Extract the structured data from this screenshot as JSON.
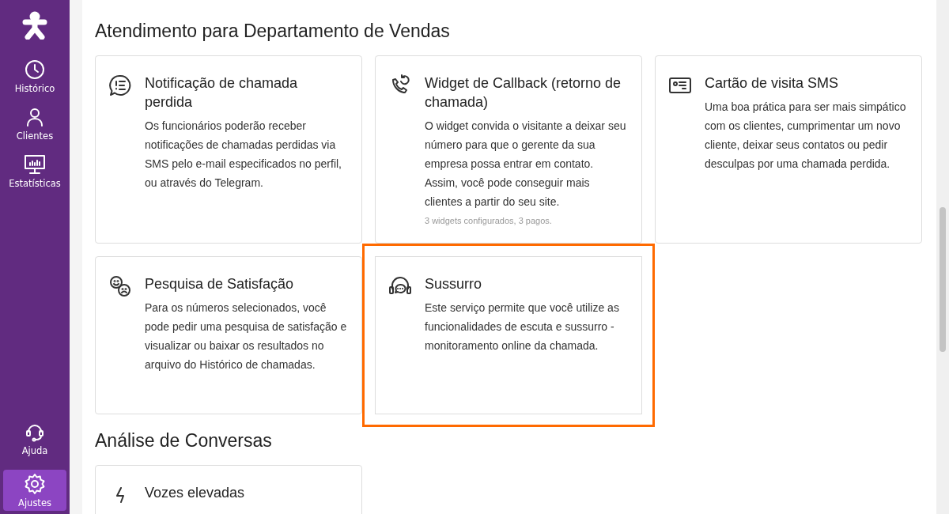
{
  "sidebar": {
    "items": [
      {
        "label": "Histórico",
        "kind": "clock",
        "selected": false
      },
      {
        "label": "Clientes",
        "kind": "person",
        "selected": false
      },
      {
        "label": "Estatísticas",
        "kind": "monitor",
        "selected": false
      }
    ],
    "bottom_items": [
      {
        "label": "Ajuda",
        "kind": "headset",
        "selected": false
      },
      {
        "label": "Ajustes",
        "kind": "gear",
        "selected": true
      }
    ]
  },
  "sections": [
    {
      "title": "Atendimento para Departamento de Vendas",
      "cards": [
        {
          "kind": "chat",
          "title": "Notificação de chamada perdida",
          "description": "Os funcionários poderão receber notificações de chamadas perdidas via SMS pelo e-mail especificados no perfil, ou através do Telegram.",
          "highlighted": false
        },
        {
          "kind": "callback",
          "title": "Widget de Callback (retorno de chamada)",
          "description": "O widget convida o visitante a deixar seu número para que o gerente da sua empresa possa entrar em contato. Assim, você pode conseguir mais clientes a partir do seu site.",
          "note": "3 widgets configurados, 3 pagos.",
          "highlighted": false
        },
        {
          "kind": "card",
          "title": "Cartão de visita SMS",
          "description": "Uma boa prática para ser mais simpático com os clientes, cumprimentar um novo cliente, deixar seus contatos ou pedir desculpas por uma chamada perdida.",
          "highlighted": false
        },
        {
          "kind": "faces",
          "title": "Pesquisa de Satisfação",
          "description": "Para os números selecionados, você pode pedir uma pesquisa de satisfação e visualizar ou baixar os resultados no arquivo do Histórico de chamadas.",
          "highlighted": false
        },
        {
          "kind": "headset",
          "title": "Sussurro",
          "description": "Este serviço permite que você utilize as funcionalidades de escuta e sussurro - monitoramento online da chamada.",
          "highlighted": true
        }
      ]
    },
    {
      "title": "Análise de Conversas",
      "cards": [
        {
          "kind": "bolt",
          "title": "Vozes elevadas"
        }
      ]
    }
  ]
}
